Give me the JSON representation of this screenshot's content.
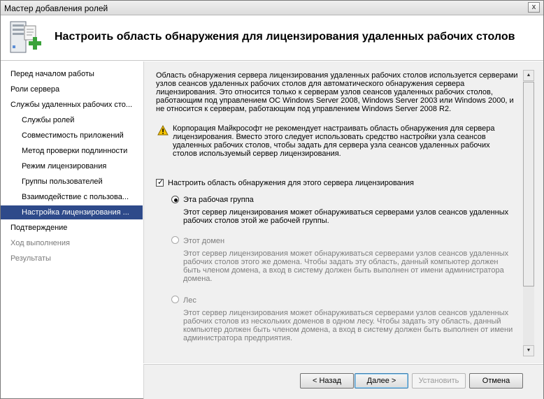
{
  "window": {
    "title": "Мастер добавления ролей",
    "close_glyph": "x"
  },
  "header": {
    "title": "Настроить область обнаружения для лицензирования удаленных рабочих столов",
    "icon": "server-add-icon"
  },
  "nav": {
    "items": [
      {
        "label": "Перед началом работы"
      },
      {
        "label": "Роли сервера"
      },
      {
        "label": "Службы удаленных рабочих сто..."
      },
      {
        "label": "Службы ролей"
      },
      {
        "label": "Совместимость приложений"
      },
      {
        "label": "Метод проверки подлинности"
      },
      {
        "label": "Режим лицензирования"
      },
      {
        "label": "Группы пользователей"
      },
      {
        "label": "Взаимодействие с пользова..."
      },
      {
        "label": "Настройка лицензирования ..."
      },
      {
        "label": "Подтверждение"
      },
      {
        "label": "Ход выполнения"
      },
      {
        "label": "Результаты"
      }
    ],
    "selected_color": "#2e4a8a"
  },
  "content": {
    "intro": "Область обнаружения сервера лицензирования удаленных рабочих столов используется серверами узлов сеансов удаленных рабочих столов для автоматического обнаружения сервера лицензирования. Это относится только к серверам узлов сеансов удаленных рабочих столов, работающим под управлением ОС Windows Server 2008, Windows Server 2003 или Windows 2000, и не относится к серверам, работающим под управлением Windows Server 2008 R2.",
    "warning": "Корпорация Майкрософт не рекомендует настраивать область обнаружения для сервера лицензирования. Вместо этого следует использовать средство настройки узла сеансов удаленных рабочих столов, чтобы задать для сервера узла сеансов удаленных рабочих столов используемый сервер лицензирования.",
    "checkbox_label": "Настроить область обнаружения для этого сервера лицензирования",
    "checkbox_checked": true,
    "options": [
      {
        "label": "Эта рабочая группа",
        "desc": "Этот сервер лицензирования может обнаруживаться серверами узлов сеансов удаленных рабочих столов этой же рабочей группы.",
        "selected": true,
        "enabled": true
      },
      {
        "label": "Этот домен",
        "desc": "Этот сервер лицензирования может обнаруживаться серверами узлов сеансов удаленных рабочих столов этого же домена. Чтобы задать эту область, данный компьютер должен быть членом домена, а вход в систему должен быть выполнен от имени администратора домена.",
        "selected": false,
        "enabled": false
      },
      {
        "label": "Лес",
        "desc": "Этот сервер лицензирования может обнаруживаться серверами узлов сеансов удаленных рабочих столов из нескольких доменов в одном лесу. Чтобы задать эту область, данный компьютер должен быть членом домена, а вход в систему должен быть выполнен от имени администратора предприятия.",
        "selected": false,
        "enabled": false
      }
    ]
  },
  "footer": {
    "back": "< Назад",
    "next": "Далее >",
    "install": "Установить",
    "cancel": "Отмена"
  }
}
